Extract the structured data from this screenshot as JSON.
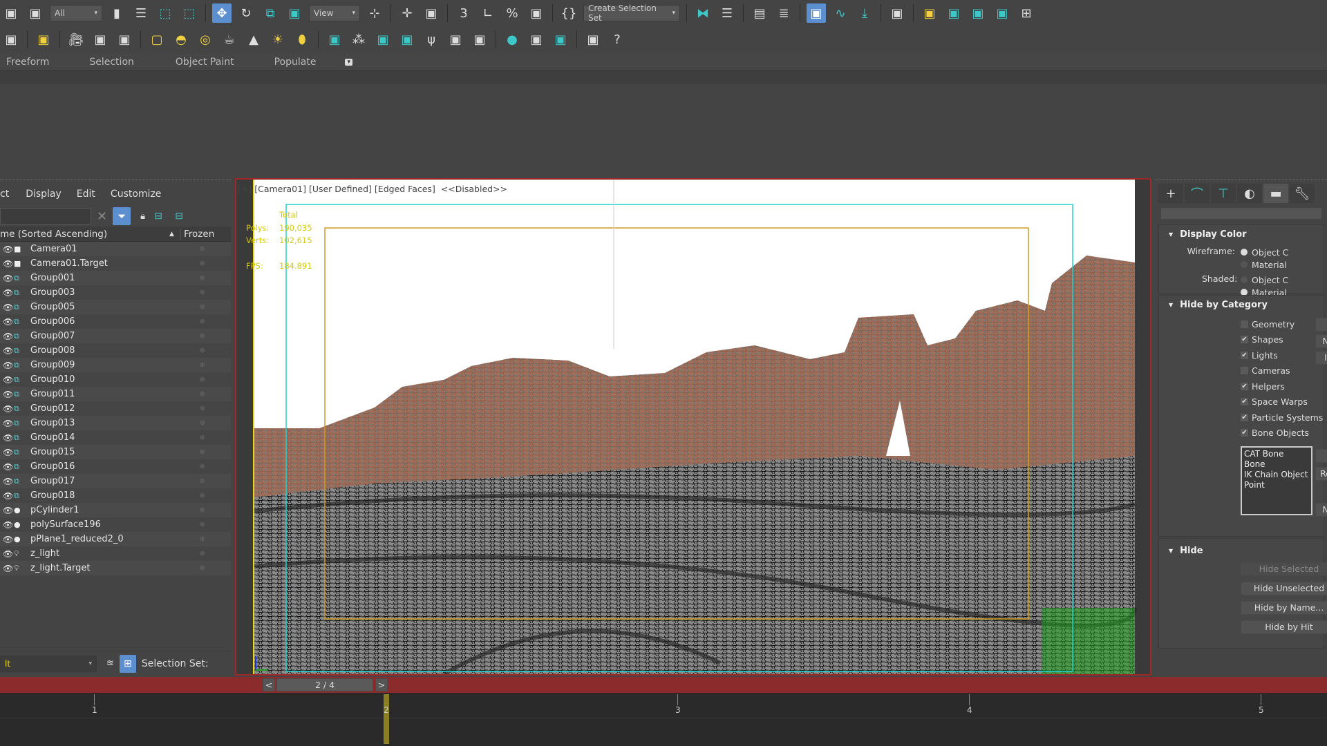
{
  "toolbar": {
    "row1": [
      {
        "icon": "unlink-icon"
      },
      {
        "icon": "bind-space-warp-icon"
      },
      {
        "dropdown": "All",
        "name": "selection-filter-dropdown",
        "w": 76
      },
      {
        "icon": "select-object-icon"
      },
      {
        "icon": "select-by-name-icon"
      },
      {
        "icon": "rectangular-selection-icon",
        "c": "teal"
      },
      {
        "icon": "window-crossing-icon",
        "c": "teal"
      },
      {
        "sep": 1
      },
      {
        "icon": "select-and-move-icon",
        "active": 1
      },
      {
        "icon": "select-and-rotate-icon"
      },
      {
        "icon": "select-and-scale-icon",
        "c": "teal"
      },
      {
        "icon": "select-and-place-icon",
        "c": "teal"
      },
      {
        "dropdown": "View",
        "name": "reference-coordinate-dropdown",
        "w": 74
      },
      {
        "icon": "pivot-center-icon"
      },
      {
        "sep": 1
      },
      {
        "icon": "select-manipulate-icon"
      },
      {
        "icon": "keyboard-shortcut-override-icon"
      },
      {
        "sep": 1
      },
      {
        "icon": "snaps-toggle-icon"
      },
      {
        "icon": "angle-snap-icon"
      },
      {
        "icon": "percent-snap-icon"
      },
      {
        "icon": "spinner-snap-icon"
      },
      {
        "sep": 1
      },
      {
        "icon": "edit-named-selection-icon"
      },
      {
        "dropdown": "Create Selection Set",
        "name": "named-selection-dropdown",
        "w": 140
      },
      {
        "sep": 1
      },
      {
        "icon": "mirror-icon",
        "c": "teal"
      },
      {
        "icon": "align-icon"
      },
      {
        "sep": 1
      },
      {
        "icon": "scene-explorer-icon"
      },
      {
        "icon": "layer-explorer-icon"
      },
      {
        "sep": 1
      },
      {
        "icon": "toggle-ribbon-icon",
        "active": 1
      },
      {
        "icon": "curve-editor-icon",
        "c": "teal"
      },
      {
        "icon": "schematic-view-icon",
        "c": "teal"
      },
      {
        "sep": 1
      },
      {
        "icon": "material-editor-icon"
      },
      {
        "sep": 1
      },
      {
        "icon": "render-setup-icon",
        "c": "yellow"
      },
      {
        "icon": "rendered-frame-window-icon",
        "c": "teal"
      },
      {
        "icon": "render-production-icon",
        "c": "teal"
      },
      {
        "icon": "render-in-cloud-icon",
        "c": "teal"
      },
      {
        "icon": "viewport-layout-icon"
      }
    ],
    "row2": [
      {
        "icon": "panel-icon"
      },
      {
        "sep": 1
      },
      {
        "icon": "light-lister-icon",
        "c": "yellow"
      },
      {
        "sep": 1
      },
      {
        "icon": "camera-icon"
      },
      {
        "icon": "camera-target-icon"
      },
      {
        "icon": "physical-camera-icon"
      },
      {
        "sep": 1
      },
      {
        "icon": "area-light-icon",
        "c": "yellow"
      },
      {
        "icon": "dome-light-icon",
        "c": "yellow"
      },
      {
        "icon": "sphere-light-icon",
        "c": "yellow"
      },
      {
        "icon": "teapot-icon"
      },
      {
        "icon": "cone-icon"
      },
      {
        "icon": "sun-icon",
        "c": "yellow"
      },
      {
        "icon": "sky-icon",
        "c": "yellow"
      },
      {
        "sep": 1
      },
      {
        "icon": "scatter-icon",
        "c": "teal"
      },
      {
        "icon": "particles-icon"
      },
      {
        "icon": "proxy-icon",
        "c": "teal"
      },
      {
        "icon": "multiscatter-icon",
        "c": "teal"
      },
      {
        "icon": "grass-icon"
      },
      {
        "icon": "hair-fur-icon"
      },
      {
        "icon": "ornatrix-icon"
      },
      {
        "sep": 1
      },
      {
        "icon": "material-sphere-icon",
        "c": "teal"
      },
      {
        "icon": "render-region-icon"
      },
      {
        "icon": "frame-buffer-icon",
        "c": "teal"
      },
      {
        "sep": 1
      },
      {
        "icon": "settings-list-icon"
      },
      {
        "icon": "help-icon"
      }
    ]
  },
  "ribbon": {
    "tabs": [
      "Freeform",
      "Selection",
      "Object Paint",
      "Populate"
    ]
  },
  "outliner": {
    "menu": [
      "ct",
      "Display",
      "Edit",
      "Customize"
    ],
    "search_value": "",
    "col_name": "me (Sorted Ascending)",
    "col_frozen": "Frozen",
    "rows": [
      {
        "name": "Camera01",
        "type": "camera"
      },
      {
        "name": "Camera01.Target",
        "type": "camera"
      },
      {
        "name": "Group001",
        "type": "group"
      },
      {
        "name": "Group003",
        "type": "group"
      },
      {
        "name": "Group005",
        "type": "group"
      },
      {
        "name": "Group006",
        "type": "group"
      },
      {
        "name": "Group007",
        "type": "group"
      },
      {
        "name": "Group008",
        "type": "group"
      },
      {
        "name": "Group009",
        "type": "group"
      },
      {
        "name": "Group010",
        "type": "group"
      },
      {
        "name": "Group011",
        "type": "group"
      },
      {
        "name": "Group012",
        "type": "group"
      },
      {
        "name": "Group013",
        "type": "group"
      },
      {
        "name": "Group014",
        "type": "group"
      },
      {
        "name": "Group015",
        "type": "group"
      },
      {
        "name": "Group016",
        "type": "group"
      },
      {
        "name": "Group017",
        "type": "group"
      },
      {
        "name": "Group018",
        "type": "group"
      },
      {
        "name": "pCylinder1",
        "type": "geometry"
      },
      {
        "name": "polySurface196",
        "type": "geometry"
      },
      {
        "name": "pPlane1_reduced2_0",
        "type": "geometry"
      },
      {
        "name": "z_light",
        "type": "light"
      },
      {
        "name": "z_light.Target",
        "type": "light"
      }
    ],
    "layer_value": "lt",
    "selection_set_label": "Selection Set:"
  },
  "viewport": {
    "labels": [
      "[+]",
      "[Camera01]",
      "[User Defined]",
      "[Edged Faces]",
      "<<Disabled>>"
    ],
    "stats": {
      "header": "Total",
      "polys_label": "Polys:",
      "polys": "190,035",
      "verts_label": "Verts:",
      "verts": "102,615",
      "fps_label": "FPS:",
      "fps": "184.891"
    }
  },
  "command_panel": {
    "tabs": [
      "create-icon",
      "modify-icon",
      "hierarchy-icon",
      "motion-icon",
      "display-icon",
      "utilities-icon"
    ],
    "display_color": {
      "title": "Display Color",
      "wireframe_label": "Wireframe:",
      "shaded_label": "Shaded:",
      "opt_object": "Object C",
      "opt_material": "Material",
      "wireframe_selected": "object",
      "shaded_selected": "material"
    },
    "hide_by_category": {
      "title": "Hide by Category",
      "items": [
        {
          "label": "Geometry",
          "checked": false
        },
        {
          "label": "Shapes",
          "checked": true
        },
        {
          "label": "Lights",
          "checked": true
        },
        {
          "label": "Cameras",
          "checked": false
        },
        {
          "label": "Helpers",
          "checked": true
        },
        {
          "label": "Space Warps",
          "checked": true
        },
        {
          "label": "Particle Systems",
          "checked": true
        },
        {
          "label": "Bone Objects",
          "checked": true
        }
      ],
      "side_buttons": [
        "",
        "N",
        "I"
      ],
      "list": [
        "CAT Bone",
        "Bone",
        "IK Chain Object",
        "Point"
      ],
      "list_buttons": [
        "",
        "Re",
        "",
        "N"
      ]
    },
    "hide": {
      "title": "Hide",
      "buttons": [
        "Hide Selected",
        "Hide Unselected",
        "Hide by Name...",
        "Hide by Hit"
      ]
    }
  },
  "timebar": {
    "prev": "<",
    "position": "2 / 4",
    "next": ">"
  },
  "timeline": {
    "ticks": [
      "1",
      "2",
      "3",
      "4",
      "5"
    ],
    "current": 2
  },
  "colors": {
    "accent": "#5b8fd0",
    "timebar": "#8b2b2b",
    "stats": "#f0e020",
    "safe_frame": "#d09a20",
    "cyan_frame": "#20d0d0"
  }
}
